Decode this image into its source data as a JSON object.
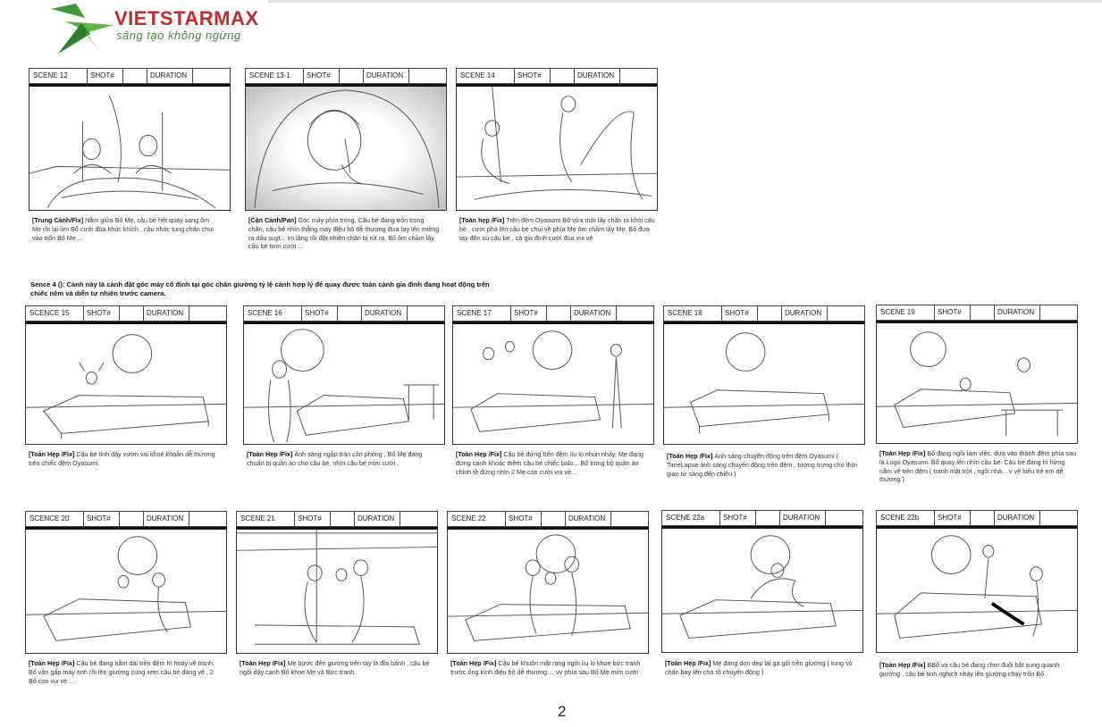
{
  "brand": {
    "name": "VIETSTARMAX",
    "tagline": "sáng tạo không ngừng"
  },
  "labels": {
    "shot": "SHOT#",
    "duration": "DURATION"
  },
  "sence_note": "Sence  4 (): Cảnh này là cảnh đặt góc máy cố định tại góc chân giường tỷ lệ cảnh hợp lý để quay được toàn cảnh gia đình đang hoạt động trên chiếc nệm và diễn tự nhiên trước camera.",
  "page_number": "2",
  "scenes": [
    {
      "id": "SCENE 12",
      "tag": "[Trung Cảnh/Fix]",
      "text": " Nằm giữa Bố Mẹ, cậu bé hết quay sang ôm Mẹ rồi lại ôm Bố cười đùa khúc khích , cậu nhóc tung chăn chui vào trốn Bố Mẹ ..."
    },
    {
      "id": "SCENE 13-1",
      "tag": "[Cận Cảnh/Pan]",
      "text": " Góc máy phía trong. Cậu bé đang trốn trong chăn, cậu bé nhìn thẳng máy điệu bộ dễ thương đưa tay lên miệng ra dấu suỵt... im lặng rồi đột nhiên chăn bị rút ra, Bố ôm chầm lấy cậu bé tươi cười ..."
    },
    {
      "id": "SCENE 14",
      "tag": "[Toàn hẹp /Fix]",
      "text": " Trên đệm Oyasumi  Bố vừa mới lấy chăn ra khỏi cậu bé , cười phá lên cậu bé chui về phía Mẹ ôm chầm lấy Mẹ. Bố đưa tay đến cù cậu bé , cả gia đình cười đùa vui vẻ"
    },
    {
      "id": "SCENCE 15",
      "tag": "[Toàn Hẹp /Fix]",
      "text": " Cậu bé tỉnh dậy vươn vai khoẻ khoắn dễ thương trên chiếc đệm Oyasumi."
    },
    {
      "id": "SCENE 16",
      "tag": "[Toàn Hẹp /Fix]",
      "text": " Ánh sáng ngập tràn căn phòng , Bố Mẹ đang chuẩn bị quần áo cho cậu bé, nhìn cậu bé mỉm cười ."
    },
    {
      "id": "SCENE 17",
      "tag": "[Toàn Hẹp /Fix]",
      "text": " Cậu bé đứng trên đệm líu lo nhún nhảy, Mẹ đang đứng cạnh khoác thêm cậu bé chiếc balo... Bố trong bộ quần áo chỉnh tề đứng nhìn 2 Mẹ con cười vui vẻ..."
    },
    {
      "id": "SCENE 18",
      "tag": "[Toàn Hẹp /Fix]",
      "text": " Ánh sáng chuyển động trên đệm Oyasumi ( TimeLapse ánh sáng chuyển động trên đệm , tượng trưng cho thời gian từ sáng đến chiều )"
    },
    {
      "id": "SCENE 19",
      "tag": "[Toàn Hẹp /Fix]",
      "text": " Bố đang ngồi làm việc, dựa vào thành đệm phía sau là Logo Oyasumi. Bố quay lên nhìn cậu bé. Cậu bé đang hí hửng nằm vẽ trên đệm ( tranh mặt trời , ngôi nhà ...v vẽ kiểu trẻ em dễ thương )"
    },
    {
      "id": "SCENCE 20",
      "tag": "[Toàn Hẹp /Fix]",
      "text": " Cậu bé đang nằm dài trên đệm hí hoáy vẽ tranh. Bố vẫn gấp máy tính  rồi lên giường cùng xem cậu bé đang vẽ , 2 Bố con vui vẻ ...."
    },
    {
      "id": "SCENE 21",
      "tag": "[Toàn Hẹp /Fix]",
      "text": " Mẹ bước đến giường trên tay là đĩa bánh , cậu bé ngồi dậy cạnh Bố khoe Mẹ và  Bức tranh."
    },
    {
      "id": "SCENE 22",
      "tag": "[Toàn Hẹp /Fix]",
      "text": " Cậu bé khuôn mặt rạng ngời líu lo khoe bức tranh trước ống kính điệu bộ dễ thương  ... vv phía sau Bố Mẹ mỉm cười ."
    },
    {
      "id": "SCENE 22a",
      "tag": "[Toàn Hẹp /Fix]",
      "text": " Mẹ đang dọn dẹp lại ga gối trên giường ( tung vỏ chăn bay lên cho rõ chuyển động )"
    },
    {
      "id": "SCENE 22b",
      "tag": "[Toàn Hẹp /Fix]",
      "text": " BBố và cậu bé đang chơi đuổi bắt xung quanh giường , cậu bé tinh nghịch nhảy lên giường chạy trốn Bố ."
    }
  ]
}
